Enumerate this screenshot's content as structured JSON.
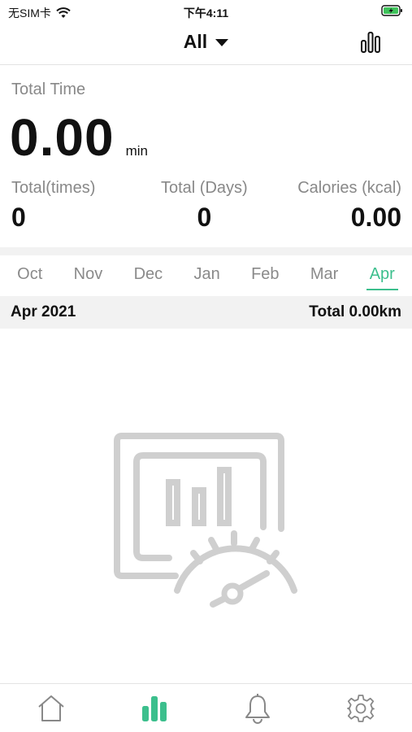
{
  "status_bar": {
    "carrier": "无SIM卡",
    "time": "下午4:11",
    "icons": [
      "wifi-icon",
      "battery-charging-icon"
    ]
  },
  "header": {
    "filter_label": "All",
    "filter_icon": "caret-down-icon",
    "chart_toggle_icon": "bar-chart-icon"
  },
  "summary": {
    "total_time_label": "Total Time",
    "total_time_value": "0.00",
    "total_time_unit": "min",
    "stats": {
      "times": {
        "label": "Total(times)",
        "value": "0"
      },
      "days": {
        "label": "Total (Days)",
        "value": "0"
      },
      "calories": {
        "label": "Calories (kcal)",
        "value": "0.00"
      }
    }
  },
  "months": {
    "items": [
      "Oct",
      "Nov",
      "Dec",
      "Jan",
      "Feb",
      "Mar",
      "Apr"
    ],
    "selected": "Apr"
  },
  "period": {
    "label": "Apr 2021",
    "total": "Total 0.00km"
  },
  "empty_state": {
    "icon": "empty-report-speedometer-icon"
  },
  "tab_bar": {
    "items": [
      {
        "name": "home",
        "icon": "home-icon",
        "active": false
      },
      {
        "name": "stats",
        "icon": "bar-chart-icon",
        "active": true
      },
      {
        "name": "notifications",
        "icon": "bell-icon",
        "active": false
      },
      {
        "name": "settings",
        "icon": "gear-icon",
        "active": false
      }
    ]
  },
  "colors": {
    "accent": "#3cbf8d",
    "muted_text": "#888888",
    "band": "#f2f2f2",
    "icon_gray": "#cfcfcf"
  }
}
